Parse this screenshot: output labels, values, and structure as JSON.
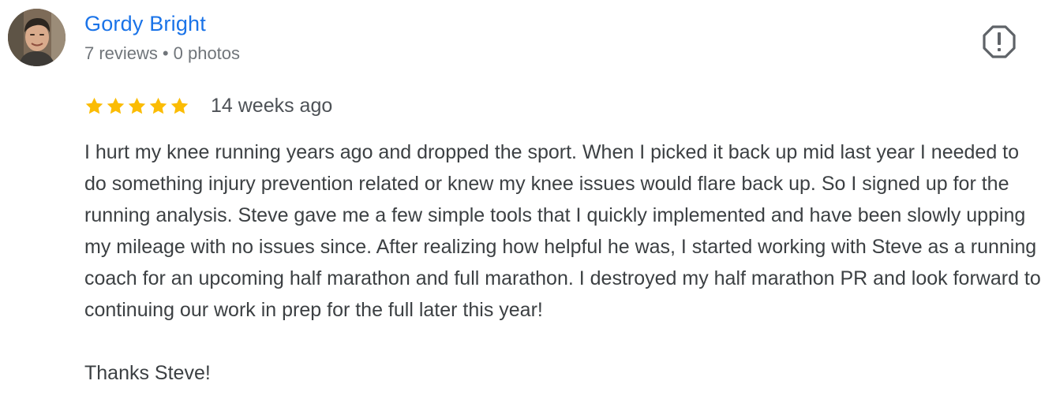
{
  "review": {
    "author": {
      "name": "Gordy Bright",
      "reviews_count": "7 reviews",
      "separator": "•",
      "photos_count": "0 photos",
      "avatar_icon": "person-photo-avatar"
    },
    "rating": {
      "stars": 5,
      "max_stars": 5,
      "star_color": "#fbbc04"
    },
    "date": "14 weeks ago",
    "text": "I hurt my knee running years ago and dropped the sport. When I picked it back up mid last year I needed to do something injury prevention related or knew my knee issues would flare back up. So I signed up for the running analysis. Steve gave me a few simple tools that I quickly implemented and have been slowly upping my mileage with no issues since. After realizing how helpful he was, I started working with Steve as a running coach for an upcoming half marathon and full marathon. I destroyed my half marathon PR and look forward to continuing our work in prep for the full later this year!\n\nThanks Steve!",
    "flag_icon": "report-flag-icon"
  },
  "colors": {
    "author_link": "#1a73e8",
    "meta_text": "#70757a",
    "body_text": "#3c4043"
  }
}
